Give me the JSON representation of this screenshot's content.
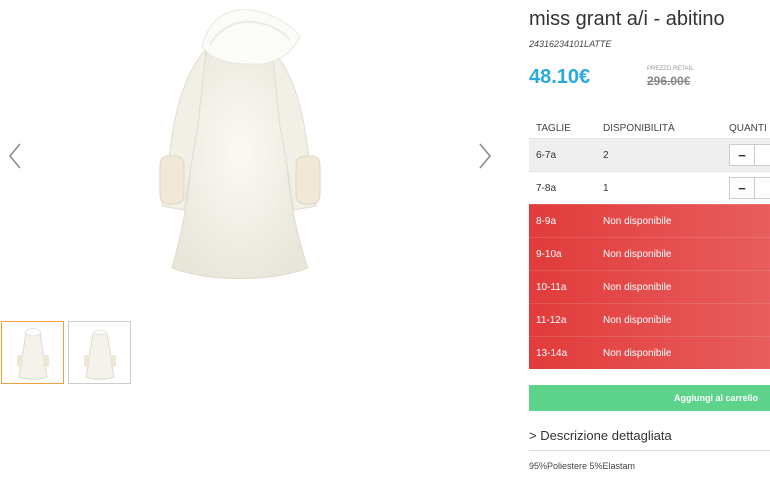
{
  "product": {
    "title": "miss grant a/i - abitino",
    "sku": "24316234101LATTE",
    "price": "48.10€",
    "retail_label": "PREZZO RETAIL",
    "retail_price": "296.00€"
  },
  "gallery": {
    "prev_icon": "chevron-left-icon",
    "next_icon": "chevron-right-icon",
    "thumbnails": 2,
    "active_thumbnail": 1
  },
  "table": {
    "headers": [
      "TAGLIE",
      "DISPONIBILITÀ",
      "QUANTI"
    ],
    "available_rows": [
      {
        "size": "6-7a",
        "availability": "2"
      },
      {
        "size": "7-8a",
        "availability": "1"
      }
    ],
    "unavailable_rows": [
      {
        "size": "8-9a",
        "availability": "Non disponibile"
      },
      {
        "size": "9-10a",
        "availability": "Non disponibile"
      },
      {
        "size": "10-11a",
        "availability": "Non disponibile"
      },
      {
        "size": "11-12a",
        "availability": "Non disponibile"
      },
      {
        "size": "13-14a",
        "availability": "Non disponibile"
      }
    ],
    "minus_label": "−"
  },
  "cart": {
    "add_label": "Aggiungi al carrello"
  },
  "description": {
    "heading": "> Descrizione dettagliata",
    "text": "95%Poliestere 5%Elastam"
  },
  "colors": {
    "price": "#29a9e0",
    "unavailable": "#e23b3b",
    "add_button": "#5ed38b",
    "thumb_active": "#f0a040"
  }
}
